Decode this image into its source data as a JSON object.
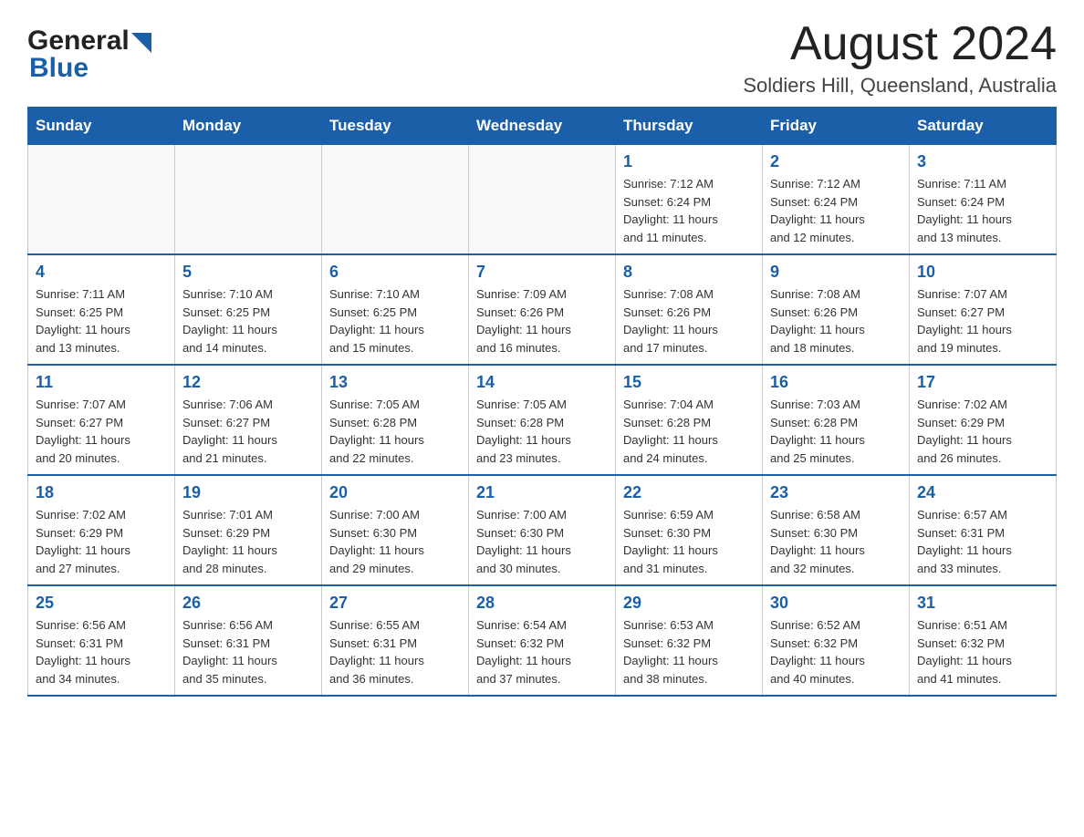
{
  "header": {
    "logo_general": "General",
    "logo_blue": "Blue",
    "title": "August 2024",
    "subtitle": "Soldiers Hill, Queensland, Australia"
  },
  "days_of_week": [
    "Sunday",
    "Monday",
    "Tuesday",
    "Wednesday",
    "Thursday",
    "Friday",
    "Saturday"
  ],
  "weeks": [
    [
      {
        "day": "",
        "info": ""
      },
      {
        "day": "",
        "info": ""
      },
      {
        "day": "",
        "info": ""
      },
      {
        "day": "",
        "info": ""
      },
      {
        "day": "1",
        "info": "Sunrise: 7:12 AM\nSunset: 6:24 PM\nDaylight: 11 hours\nand 11 minutes."
      },
      {
        "day": "2",
        "info": "Sunrise: 7:12 AM\nSunset: 6:24 PM\nDaylight: 11 hours\nand 12 minutes."
      },
      {
        "day": "3",
        "info": "Sunrise: 7:11 AM\nSunset: 6:24 PM\nDaylight: 11 hours\nand 13 minutes."
      }
    ],
    [
      {
        "day": "4",
        "info": "Sunrise: 7:11 AM\nSunset: 6:25 PM\nDaylight: 11 hours\nand 13 minutes."
      },
      {
        "day": "5",
        "info": "Sunrise: 7:10 AM\nSunset: 6:25 PM\nDaylight: 11 hours\nand 14 minutes."
      },
      {
        "day": "6",
        "info": "Sunrise: 7:10 AM\nSunset: 6:25 PM\nDaylight: 11 hours\nand 15 minutes."
      },
      {
        "day": "7",
        "info": "Sunrise: 7:09 AM\nSunset: 6:26 PM\nDaylight: 11 hours\nand 16 minutes."
      },
      {
        "day": "8",
        "info": "Sunrise: 7:08 AM\nSunset: 6:26 PM\nDaylight: 11 hours\nand 17 minutes."
      },
      {
        "day": "9",
        "info": "Sunrise: 7:08 AM\nSunset: 6:26 PM\nDaylight: 11 hours\nand 18 minutes."
      },
      {
        "day": "10",
        "info": "Sunrise: 7:07 AM\nSunset: 6:27 PM\nDaylight: 11 hours\nand 19 minutes."
      }
    ],
    [
      {
        "day": "11",
        "info": "Sunrise: 7:07 AM\nSunset: 6:27 PM\nDaylight: 11 hours\nand 20 minutes."
      },
      {
        "day": "12",
        "info": "Sunrise: 7:06 AM\nSunset: 6:27 PM\nDaylight: 11 hours\nand 21 minutes."
      },
      {
        "day": "13",
        "info": "Sunrise: 7:05 AM\nSunset: 6:28 PM\nDaylight: 11 hours\nand 22 minutes."
      },
      {
        "day": "14",
        "info": "Sunrise: 7:05 AM\nSunset: 6:28 PM\nDaylight: 11 hours\nand 23 minutes."
      },
      {
        "day": "15",
        "info": "Sunrise: 7:04 AM\nSunset: 6:28 PM\nDaylight: 11 hours\nand 24 minutes."
      },
      {
        "day": "16",
        "info": "Sunrise: 7:03 AM\nSunset: 6:28 PM\nDaylight: 11 hours\nand 25 minutes."
      },
      {
        "day": "17",
        "info": "Sunrise: 7:02 AM\nSunset: 6:29 PM\nDaylight: 11 hours\nand 26 minutes."
      }
    ],
    [
      {
        "day": "18",
        "info": "Sunrise: 7:02 AM\nSunset: 6:29 PM\nDaylight: 11 hours\nand 27 minutes."
      },
      {
        "day": "19",
        "info": "Sunrise: 7:01 AM\nSunset: 6:29 PM\nDaylight: 11 hours\nand 28 minutes."
      },
      {
        "day": "20",
        "info": "Sunrise: 7:00 AM\nSunset: 6:30 PM\nDaylight: 11 hours\nand 29 minutes."
      },
      {
        "day": "21",
        "info": "Sunrise: 7:00 AM\nSunset: 6:30 PM\nDaylight: 11 hours\nand 30 minutes."
      },
      {
        "day": "22",
        "info": "Sunrise: 6:59 AM\nSunset: 6:30 PM\nDaylight: 11 hours\nand 31 minutes."
      },
      {
        "day": "23",
        "info": "Sunrise: 6:58 AM\nSunset: 6:30 PM\nDaylight: 11 hours\nand 32 minutes."
      },
      {
        "day": "24",
        "info": "Sunrise: 6:57 AM\nSunset: 6:31 PM\nDaylight: 11 hours\nand 33 minutes."
      }
    ],
    [
      {
        "day": "25",
        "info": "Sunrise: 6:56 AM\nSunset: 6:31 PM\nDaylight: 11 hours\nand 34 minutes."
      },
      {
        "day": "26",
        "info": "Sunrise: 6:56 AM\nSunset: 6:31 PM\nDaylight: 11 hours\nand 35 minutes."
      },
      {
        "day": "27",
        "info": "Sunrise: 6:55 AM\nSunset: 6:31 PM\nDaylight: 11 hours\nand 36 minutes."
      },
      {
        "day": "28",
        "info": "Sunrise: 6:54 AM\nSunset: 6:32 PM\nDaylight: 11 hours\nand 37 minutes."
      },
      {
        "day": "29",
        "info": "Sunrise: 6:53 AM\nSunset: 6:32 PM\nDaylight: 11 hours\nand 38 minutes."
      },
      {
        "day": "30",
        "info": "Sunrise: 6:52 AM\nSunset: 6:32 PM\nDaylight: 11 hours\nand 40 minutes."
      },
      {
        "day": "31",
        "info": "Sunrise: 6:51 AM\nSunset: 6:32 PM\nDaylight: 11 hours\nand 41 minutes."
      }
    ]
  ]
}
